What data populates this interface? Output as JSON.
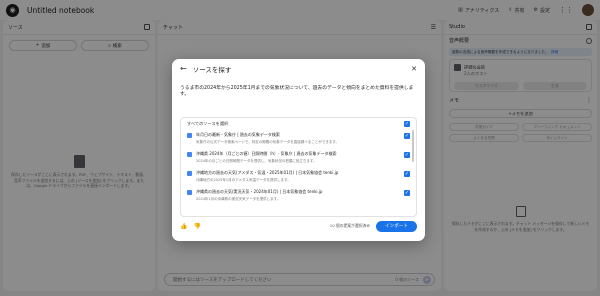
{
  "app": {
    "title": "Untitled notebook",
    "actions": [
      "アナリティクス",
      "共有",
      "設定"
    ]
  },
  "sources": {
    "header": "ソース",
    "add_label": "追加",
    "discover_label": "検索",
    "empty_text": "保存したソースがここに表示されます。PDF、ウェブサイト、テキスト、動画、音声ファイルを追加するには、上の [ソースを追加] をクリックします。または、Google ドライブからファイルを直接インポートします。"
  },
  "chat": {
    "header": "チャット",
    "input_placeholder": "開始するにはソースをアップロードしてください",
    "source_count": "0 個のソース"
  },
  "studio": {
    "header": "Studio",
    "audio_section": "音声概要",
    "banner_text": "複数の言語による音声概要を作成できるようになりました。",
    "banner_link": "詳細",
    "audio_title": "詳細な会話",
    "audio_subtitle": "2人のホスト",
    "customize_label": "カスタマイズ",
    "generate_label": "生成",
    "memo_section": "メモ",
    "add_memo_label": "メモを追加",
    "memo_buttons": [
      "学習ガイド",
      "ブリーフィング ドキュメント",
      "よくある質問",
      "タイムライン"
    ],
    "empty_text": "保存したメモがここに表示されます。チャット メッセージを保存して新しいメモを作成するか、上の [メモを追加] をクリックします。"
  },
  "modal": {
    "title": "ソースを探す",
    "query": "うるま市の2024年から2025年1月までの気象状況について、過去のデータと傾向をまとめた資料を提供します。",
    "select_all_label": "すべてのソースを選択",
    "results": [
      {
        "title": "年月日の最新・気象庁 | 過去の気象データ検索",
        "snippet": "気象庁の公式データ検索ページで、特定の期間の気象データを直接調べることができます。"
      },
      {
        "title": "沖縄県 2024年（月ごとの値）日照時間（h）- 気象庁 | 過去の気象データ検索",
        "snippet": "2024年の月ごとの日照時間データを提供し、気象状況の把握に役立ちます。"
      },
      {
        "title": "沖縄地方の過去の天気(アメダス・気温・2025年01月) | 日本気象協会 tenki.jp",
        "snippet": "沖縄地方の2025年1月のアメダス気温データを提供します。"
      },
      {
        "title": "沖縄県の過去の天気(実況天気・2024年01月) | 日本気象協会 tenki.jp",
        "snippet": "2024年1月の沖縄県の実況天気データを提供します。"
      }
    ],
    "selected_count": "10 個の提案が選択済み",
    "import_label": "インポート"
  }
}
